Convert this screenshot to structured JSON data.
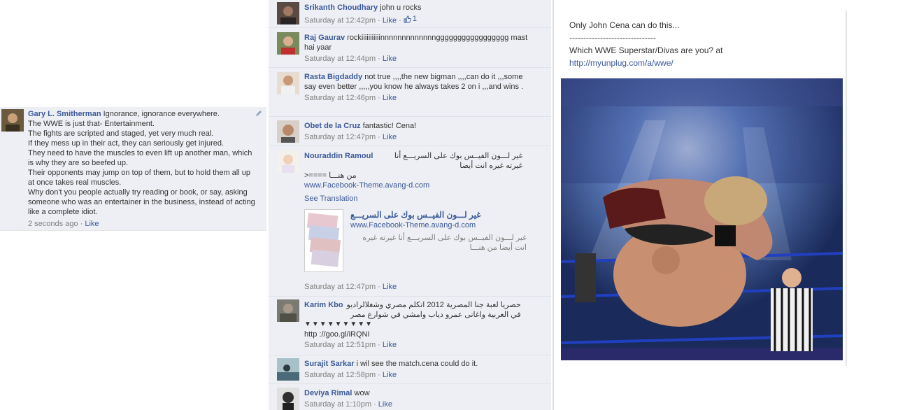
{
  "left_comment": {
    "author": "Gary L. Smitherman",
    "text_first": "Ignorance, ignorance everywhere.",
    "lines": [
      "The WWE is just that- Entertainment.",
      "The fights are scripted and staged, yet very much real.",
      "If they mess up in their act, they can seriously get injured.",
      "They need to have the muscles to even lift up another man, which is why they are so beefed up.",
      "Their opponents may jump on top of them, but to hold them all up at once takes real muscles.",
      "Why don't you people actually try reading or book, or say, asking someone who was an entertainer in the business, instead of acting like a complete idiot."
    ],
    "time": "2 seconds ago",
    "like": "Like"
  },
  "comments": [
    {
      "author": "Srikanth Choudhary",
      "text": "john u rocks",
      "time": "Saturday at 12:42pm",
      "like": "Like",
      "likes": "1"
    },
    {
      "author": "Raj Gaurav",
      "text": "rockiiiiiiiiiiinnnnnnnnnnnnnggggggggggggggggg mast hai yaar",
      "time": "Saturday at 12:44pm",
      "like": "Like"
    },
    {
      "author": "Rasta Bigdaddy",
      "text": "not true ,,,,the new bigman ,,,,can do it ,,,some say even better ,,,,,you know he always takes 2 on i ,,,and wins .",
      "time": "Saturday at 12:46pm",
      "like": "Like"
    },
    {
      "author": "Obet de la Cruz",
      "text": "fantastic! Cena!",
      "time": "Saturday at 12:47pm",
      "like": "Like"
    },
    {
      "author": "Nouraddin Ramoul",
      "text": "غير لـــون الفيــس بوك على السريـــع أنا غيرته غيره انت أيضا",
      "text2": "من هنـــا ====<",
      "url": "www.Facebook-Theme.avang-d.com",
      "see_translation": "See Translation",
      "preview_title": "غير لـــون الفيــس بوك على السريـــع",
      "preview_url": "www.Facebook-Theme.avang-d.com",
      "preview_desc": "غير لـــون الفيــس بوك على السريـــع أنا غيرته غيره انت أيضا من هنـــا",
      "time": "Saturday at 12:47pm",
      "like": "Like"
    },
    {
      "author": "Karim Kbo",
      "text": "حصريا لعبة جنا المصرية 2012 اتكلم مصري وشغلالراديو في العربية واغانى عمرو دياب وامشي في شوارع مصر",
      "arrows": "▼▼▼▼▼▼▼▼▼",
      "link": "http ://goo.gl/iRQNI",
      "time": "Saturday at 12:51pm",
      "like": "Like"
    },
    {
      "author": "Surajit Sarkar",
      "text": "i wil see the match.cena could do it.",
      "time": "Saturday at 12:58pm",
      "like": "Like"
    },
    {
      "author": "Deviya Rimal",
      "text": "wow",
      "time": "Saturday at 1:10pm",
      "like": "Like"
    }
  ],
  "separator": " · ",
  "caption": {
    "line1": "Only John Cena can do this...",
    "line2": "-------------------------------",
    "line3": "Which WWE Superstar/Divas are you? at",
    "link": "http://myunplug.com/a/wwe/"
  },
  "colors": {
    "link": "#3b5998",
    "panel": "#edeff4",
    "meta": "#808080"
  }
}
